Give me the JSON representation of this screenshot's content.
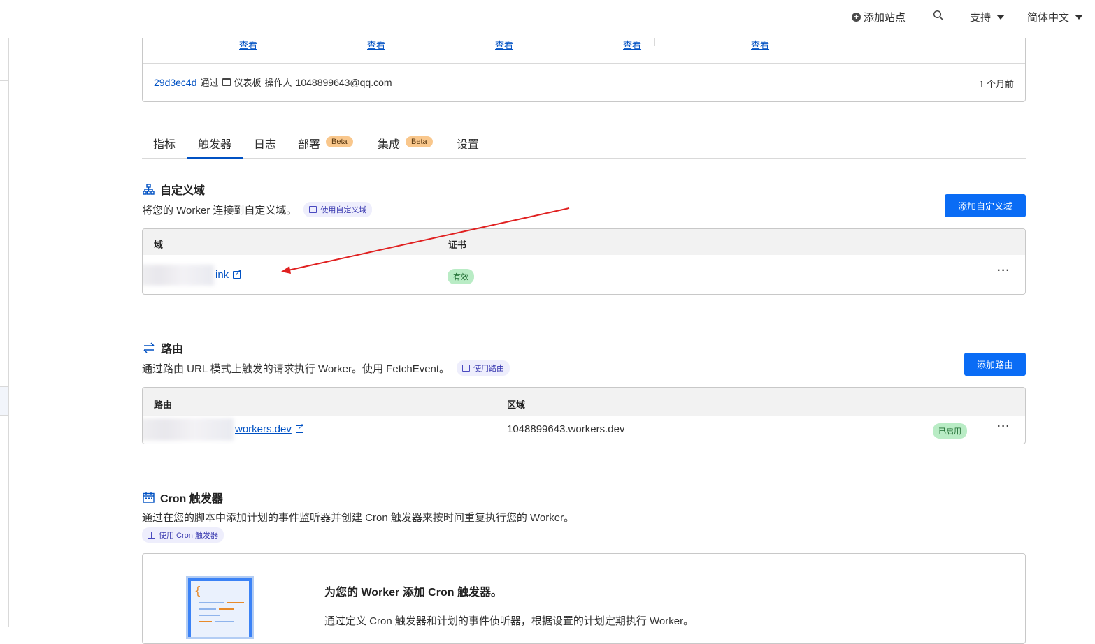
{
  "topbar": {
    "add_site": "添加站点",
    "support": "支持",
    "language": "简体中文"
  },
  "deployment": {
    "stat_link": "查看",
    "hash": "29d3ec4d",
    "via": "通过",
    "source": "仪表板",
    "operator_label": "操作人",
    "operator": "1048899643@qq.com",
    "time_ago": "1 个月前"
  },
  "tabs": [
    {
      "label": "指标"
    },
    {
      "label": "触发器",
      "active": true
    },
    {
      "label": "日志"
    },
    {
      "label": "部署",
      "badge": "Beta"
    },
    {
      "label": "集成",
      "badge": "Beta"
    },
    {
      "label": "设置"
    }
  ],
  "custom_domains": {
    "title": "自定义域",
    "description": "将您的 Worker 连接到自定义域。",
    "doc_link": "使用自定义域",
    "add_button": "添加自定义域",
    "columns": [
      "域",
      "证书"
    ],
    "rows": [
      {
        "domain_visible": "ink",
        "cert_status": "有效"
      }
    ]
  },
  "routes": {
    "title": "路由",
    "description": "通过路由 URL 模式上触发的请求执行 Worker。使用 FetchEvent。",
    "doc_link": "使用路由",
    "add_button": "添加路由",
    "columns": [
      "路由",
      "区域"
    ],
    "rows": [
      {
        "route_visible": "workers.dev",
        "zone": "1048899643.workers.dev",
        "status": "已启用"
      }
    ]
  },
  "cron": {
    "title": "Cron 触发器",
    "description": "通过在您的脚本中添加计划的事件监听器并创建 Cron 触发器来按时间重复执行您的 Worker。",
    "doc_link": "使用 Cron 触发器",
    "card_title": "为您的 Worker 添加 Cron 触发器。",
    "card_desc": "通过定义 Cron 触发器和计划的事件侦听器，根据设置的计划定期执行 Worker。"
  },
  "colors": {
    "primary_button": "#0a6cf5",
    "link": "#0051c3",
    "annotation_arrow": "#e02020",
    "beta_badge": "#f9c78c",
    "success_badge": "#b9ecc5"
  }
}
